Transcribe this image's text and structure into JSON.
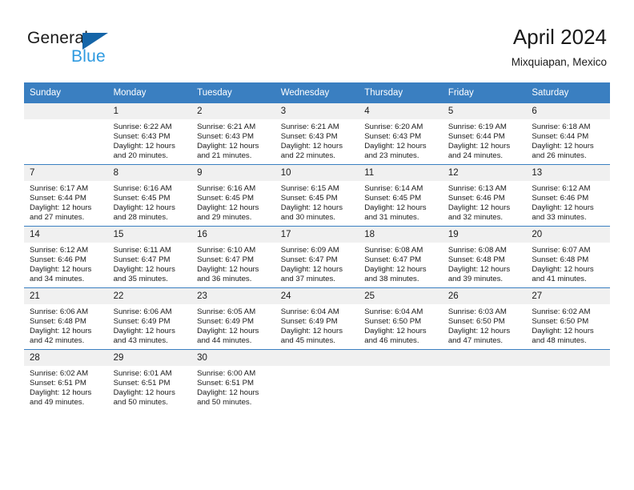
{
  "brand": {
    "name_part1": "General",
    "name_part2": "Blue",
    "logo_icon": "triangle-flag-icon"
  },
  "header": {
    "title": "April 2024",
    "subtitle": "Mixquiapan, Mexico"
  },
  "weekday_headers": [
    "Sunday",
    "Monday",
    "Tuesday",
    "Wednesday",
    "Thursday",
    "Friday",
    "Saturday"
  ],
  "colors": {
    "header_blue": "#3a7fc1",
    "daynum_band": "#f0f0f0",
    "brand_blue": "#2e9ae0",
    "logo_blue": "#1565a8",
    "text": "#1a1a1a"
  },
  "weeks": [
    [
      {
        "day": "",
        "sunrise": "",
        "sunset": "",
        "daylight_line1": "",
        "daylight_line2": ""
      },
      {
        "day": "1",
        "sunrise": "Sunrise: 6:22 AM",
        "sunset": "Sunset: 6:43 PM",
        "daylight_line1": "Daylight: 12 hours",
        "daylight_line2": "and 20 minutes."
      },
      {
        "day": "2",
        "sunrise": "Sunrise: 6:21 AM",
        "sunset": "Sunset: 6:43 PM",
        "daylight_line1": "Daylight: 12 hours",
        "daylight_line2": "and 21 minutes."
      },
      {
        "day": "3",
        "sunrise": "Sunrise: 6:21 AM",
        "sunset": "Sunset: 6:43 PM",
        "daylight_line1": "Daylight: 12 hours",
        "daylight_line2": "and 22 minutes."
      },
      {
        "day": "4",
        "sunrise": "Sunrise: 6:20 AM",
        "sunset": "Sunset: 6:43 PM",
        "daylight_line1": "Daylight: 12 hours",
        "daylight_line2": "and 23 minutes."
      },
      {
        "day": "5",
        "sunrise": "Sunrise: 6:19 AM",
        "sunset": "Sunset: 6:44 PM",
        "daylight_line1": "Daylight: 12 hours",
        "daylight_line2": "and 24 minutes."
      },
      {
        "day": "6",
        "sunrise": "Sunrise: 6:18 AM",
        "sunset": "Sunset: 6:44 PM",
        "daylight_line1": "Daylight: 12 hours",
        "daylight_line2": "and 26 minutes."
      }
    ],
    [
      {
        "day": "7",
        "sunrise": "Sunrise: 6:17 AM",
        "sunset": "Sunset: 6:44 PM",
        "daylight_line1": "Daylight: 12 hours",
        "daylight_line2": "and 27 minutes."
      },
      {
        "day": "8",
        "sunrise": "Sunrise: 6:16 AM",
        "sunset": "Sunset: 6:45 PM",
        "daylight_line1": "Daylight: 12 hours",
        "daylight_line2": "and 28 minutes."
      },
      {
        "day": "9",
        "sunrise": "Sunrise: 6:16 AM",
        "sunset": "Sunset: 6:45 PM",
        "daylight_line1": "Daylight: 12 hours",
        "daylight_line2": "and 29 minutes."
      },
      {
        "day": "10",
        "sunrise": "Sunrise: 6:15 AM",
        "sunset": "Sunset: 6:45 PM",
        "daylight_line1": "Daylight: 12 hours",
        "daylight_line2": "and 30 minutes."
      },
      {
        "day": "11",
        "sunrise": "Sunrise: 6:14 AM",
        "sunset": "Sunset: 6:45 PM",
        "daylight_line1": "Daylight: 12 hours",
        "daylight_line2": "and 31 minutes."
      },
      {
        "day": "12",
        "sunrise": "Sunrise: 6:13 AM",
        "sunset": "Sunset: 6:46 PM",
        "daylight_line1": "Daylight: 12 hours",
        "daylight_line2": "and 32 minutes."
      },
      {
        "day": "13",
        "sunrise": "Sunrise: 6:12 AM",
        "sunset": "Sunset: 6:46 PM",
        "daylight_line1": "Daylight: 12 hours",
        "daylight_line2": "and 33 minutes."
      }
    ],
    [
      {
        "day": "14",
        "sunrise": "Sunrise: 6:12 AM",
        "sunset": "Sunset: 6:46 PM",
        "daylight_line1": "Daylight: 12 hours",
        "daylight_line2": "and 34 minutes."
      },
      {
        "day": "15",
        "sunrise": "Sunrise: 6:11 AM",
        "sunset": "Sunset: 6:47 PM",
        "daylight_line1": "Daylight: 12 hours",
        "daylight_line2": "and 35 minutes."
      },
      {
        "day": "16",
        "sunrise": "Sunrise: 6:10 AM",
        "sunset": "Sunset: 6:47 PM",
        "daylight_line1": "Daylight: 12 hours",
        "daylight_line2": "and 36 minutes."
      },
      {
        "day": "17",
        "sunrise": "Sunrise: 6:09 AM",
        "sunset": "Sunset: 6:47 PM",
        "daylight_line1": "Daylight: 12 hours",
        "daylight_line2": "and 37 minutes."
      },
      {
        "day": "18",
        "sunrise": "Sunrise: 6:08 AM",
        "sunset": "Sunset: 6:47 PM",
        "daylight_line1": "Daylight: 12 hours",
        "daylight_line2": "and 38 minutes."
      },
      {
        "day": "19",
        "sunrise": "Sunrise: 6:08 AM",
        "sunset": "Sunset: 6:48 PM",
        "daylight_line1": "Daylight: 12 hours",
        "daylight_line2": "and 39 minutes."
      },
      {
        "day": "20",
        "sunrise": "Sunrise: 6:07 AM",
        "sunset": "Sunset: 6:48 PM",
        "daylight_line1": "Daylight: 12 hours",
        "daylight_line2": "and 41 minutes."
      }
    ],
    [
      {
        "day": "21",
        "sunrise": "Sunrise: 6:06 AM",
        "sunset": "Sunset: 6:48 PM",
        "daylight_line1": "Daylight: 12 hours",
        "daylight_line2": "and 42 minutes."
      },
      {
        "day": "22",
        "sunrise": "Sunrise: 6:06 AM",
        "sunset": "Sunset: 6:49 PM",
        "daylight_line1": "Daylight: 12 hours",
        "daylight_line2": "and 43 minutes."
      },
      {
        "day": "23",
        "sunrise": "Sunrise: 6:05 AM",
        "sunset": "Sunset: 6:49 PM",
        "daylight_line1": "Daylight: 12 hours",
        "daylight_line2": "and 44 minutes."
      },
      {
        "day": "24",
        "sunrise": "Sunrise: 6:04 AM",
        "sunset": "Sunset: 6:49 PM",
        "daylight_line1": "Daylight: 12 hours",
        "daylight_line2": "and 45 minutes."
      },
      {
        "day": "25",
        "sunrise": "Sunrise: 6:04 AM",
        "sunset": "Sunset: 6:50 PM",
        "daylight_line1": "Daylight: 12 hours",
        "daylight_line2": "and 46 minutes."
      },
      {
        "day": "26",
        "sunrise": "Sunrise: 6:03 AM",
        "sunset": "Sunset: 6:50 PM",
        "daylight_line1": "Daylight: 12 hours",
        "daylight_line2": "and 47 minutes."
      },
      {
        "day": "27",
        "sunrise": "Sunrise: 6:02 AM",
        "sunset": "Sunset: 6:50 PM",
        "daylight_line1": "Daylight: 12 hours",
        "daylight_line2": "and 48 minutes."
      }
    ],
    [
      {
        "day": "28",
        "sunrise": "Sunrise: 6:02 AM",
        "sunset": "Sunset: 6:51 PM",
        "daylight_line1": "Daylight: 12 hours",
        "daylight_line2": "and 49 minutes."
      },
      {
        "day": "29",
        "sunrise": "Sunrise: 6:01 AM",
        "sunset": "Sunset: 6:51 PM",
        "daylight_line1": "Daylight: 12 hours",
        "daylight_line2": "and 50 minutes."
      },
      {
        "day": "30",
        "sunrise": "Sunrise: 6:00 AM",
        "sunset": "Sunset: 6:51 PM",
        "daylight_line1": "Daylight: 12 hours",
        "daylight_line2": "and 50 minutes."
      },
      {
        "day": "",
        "sunrise": "",
        "sunset": "",
        "daylight_line1": "",
        "daylight_line2": ""
      },
      {
        "day": "",
        "sunrise": "",
        "sunset": "",
        "daylight_line1": "",
        "daylight_line2": ""
      },
      {
        "day": "",
        "sunrise": "",
        "sunset": "",
        "daylight_line1": "",
        "daylight_line2": ""
      },
      {
        "day": "",
        "sunrise": "",
        "sunset": "",
        "daylight_line1": "",
        "daylight_line2": ""
      }
    ]
  ]
}
